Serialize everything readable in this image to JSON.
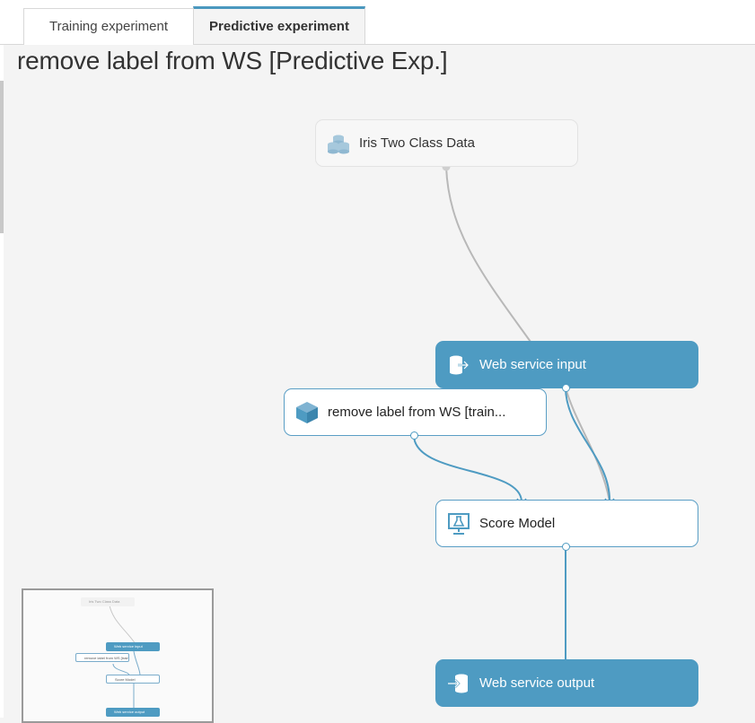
{
  "tabs": [
    {
      "label": "Training experiment",
      "active": false
    },
    {
      "label": "Predictive experiment",
      "active": true
    }
  ],
  "experiment_title": "remove label from WS [Predictive Exp.]",
  "nodes": {
    "iris": {
      "label": "Iris Two Class Data",
      "icon": "dataset-icon"
    },
    "ws_input": {
      "label": "Web service input",
      "icon": "web-service-input-icon"
    },
    "trained_model": {
      "label": "remove label from WS [train...",
      "icon": "trained-model-icon"
    },
    "score_model": {
      "label": "Score Model",
      "icon": "score-model-icon"
    },
    "ws_output": {
      "label": "Web service output",
      "icon": "web-service-output-icon"
    }
  },
  "minimap": {
    "iris": "Iris Two Class Data",
    "ws_input": "Web service input",
    "trained_model": "remove label from WS [train...",
    "score_model": "Score Model",
    "ws_output": "Web service output"
  },
  "colors": {
    "accent": "#4e9bc2",
    "edge_gray": "#b8b8b8",
    "canvas": "#f4f4f4"
  }
}
